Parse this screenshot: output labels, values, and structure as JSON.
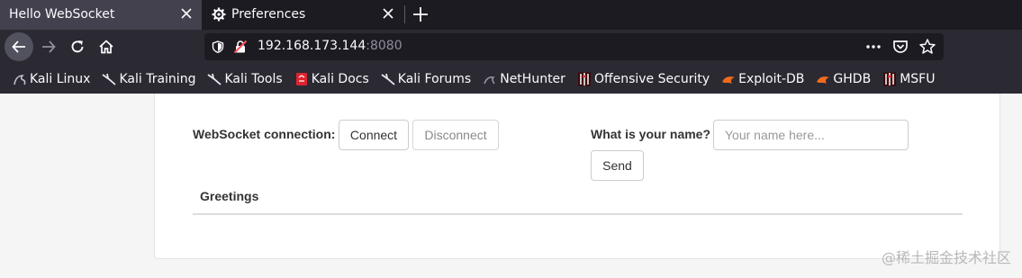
{
  "tabs": [
    {
      "title": "Hello WebSocket",
      "active": true
    },
    {
      "title": "Preferences",
      "active": false,
      "icon": "gear-icon"
    }
  ],
  "nav": {
    "url_host": "192.168.173.144",
    "url_port": ":8080"
  },
  "bookmarks": [
    {
      "label": "Kali Linux",
      "icon": "kali-dragon-icon"
    },
    {
      "label": "Kali Training",
      "icon": "kali-dragon-icon"
    },
    {
      "label": "Kali Tools",
      "icon": "kali-dragon-icon"
    },
    {
      "label": "Kali Docs",
      "icon": "kali-docs-icon"
    },
    {
      "label": "Kali Forums",
      "icon": "kali-dragon-icon"
    },
    {
      "label": "NetHunter",
      "icon": "nethunter-icon"
    },
    {
      "label": "Offensive Security",
      "icon": "offsec-icon"
    },
    {
      "label": "Exploit-DB",
      "icon": "exploitdb-icon"
    },
    {
      "label": "GHDB",
      "icon": "exploitdb-icon"
    },
    {
      "label": "MSFU",
      "icon": "offsec-icon"
    }
  ],
  "page": {
    "connection_label": "WebSocket connection:",
    "connect_label": "Connect",
    "disconnect_label": "Disconnect",
    "name_label": "What is your name?",
    "name_placeholder": "Your name here...",
    "name_value": "",
    "send_label": "Send",
    "greetings_label": "Greetings"
  },
  "watermark": "@稀土掘金技术社区",
  "colors": {
    "chrome_dark": "#1c1b22",
    "toolbar": "#2b2a33",
    "active_tab": "#42414d",
    "page_bg": "#f5f5f5",
    "panel_bg": "#ffffff"
  }
}
